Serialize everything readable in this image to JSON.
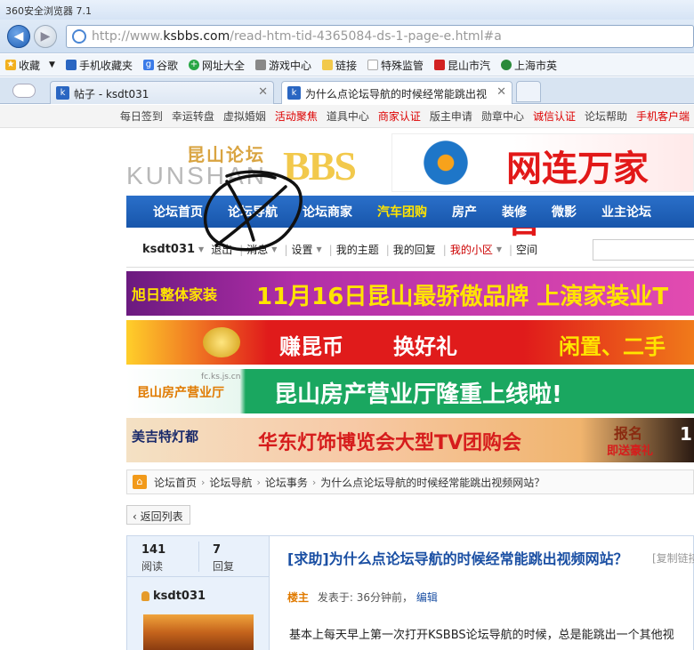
{
  "window": {
    "title": "360安全浏览器 7.1"
  },
  "addressbar": {
    "url_prefix": "http://www.",
    "url_domain": "ksbbs.com",
    "url_path": "/read-htm-tid-4365084-ds-1-page-e.html#a"
  },
  "bookmarks": [
    {
      "label": "收藏",
      "icon": "star-icon",
      "color": "#f2b01e"
    },
    {
      "label": "手机收藏夹",
      "icon": "phone-icon",
      "color": "#2a66c2"
    },
    {
      "label": "谷歌",
      "icon": "google-icon",
      "color": "#3b7be8"
    },
    {
      "label": "网址大全",
      "icon": "plus-icon",
      "color": "#28a745"
    },
    {
      "label": "游戏中心",
      "icon": "gamepad-icon",
      "color": "#888888"
    },
    {
      "label": "链接",
      "icon": "folder-icon",
      "color": "#f2c94c"
    },
    {
      "label": "特殊监管",
      "icon": "page-icon",
      "color": "#aaaaaa"
    },
    {
      "label": "昆山市汽",
      "icon": "bbs-icon",
      "color": "#d22222"
    },
    {
      "label": "上海市英",
      "icon": "globe-icon",
      "color": "#2a8a3a"
    }
  ],
  "tabs": [
    {
      "label": "帖子 - ksdt031"
    },
    {
      "label": "为什么点论坛导航的时候经常能跳出视"
    }
  ],
  "site_topbar": [
    {
      "label": "每日签到",
      "red": false
    },
    {
      "label": "幸运转盘",
      "red": false
    },
    {
      "label": "虚拟婚姻",
      "red": false
    },
    {
      "label": "活动聚焦",
      "red": true
    },
    {
      "label": "道具中心",
      "red": false
    },
    {
      "label": "商家认证",
      "red": true
    },
    {
      "label": "版主申请",
      "red": false
    },
    {
      "label": "勋章中心",
      "red": false
    },
    {
      "label": "诚信认证",
      "red": true
    },
    {
      "label": "论坛帮助",
      "red": false
    },
    {
      "label": "手机客户端",
      "red": true
    }
  ],
  "logo": {
    "cn": "昆山论坛",
    "en": "KUNSHAN",
    "bbs": "BBS"
  },
  "top_ad": {
    "text": "网连万家 智"
  },
  "main_nav": [
    {
      "label": "论坛首页",
      "hl": false
    },
    {
      "label": "论坛导航",
      "hl": false
    },
    {
      "label": "论坛商家",
      "hl": false
    },
    {
      "label": "汽车团购",
      "hl": true
    },
    {
      "label": "房产",
      "hl": false
    },
    {
      "label": "装修",
      "hl": false
    },
    {
      "label": "微影",
      "hl": false
    },
    {
      "label": "业主论坛",
      "hl": false
    }
  ],
  "userbar": {
    "username": "ksdt031",
    "logout": "退出",
    "messages": "消息",
    "settings": "设置",
    "my_topics": "我的主题",
    "my_replies": "我的回复",
    "my_area": "我的小区",
    "space": "空间"
  },
  "banners": [
    {
      "brand": "旭日整体家装",
      "text": "11月16日昆山最骄傲品牌 上演家装业T"
    },
    {
      "text1": "赚昆币",
      "text2": "换好礼",
      "text3": "闲置、二手"
    },
    {
      "brand": "昆山房产营业厅",
      "url": "fc.ks.js.cn",
      "text": "昆山房产营业厅隆重上线啦!"
    },
    {
      "brand": "美吉特灯都",
      "text": "华东灯饰博览会大型TV团购会",
      "badge1": "报名",
      "badge2": "即送豪礼",
      "corner": "1"
    }
  ],
  "breadcrumb": [
    "论坛首页",
    "论坛导航",
    "论坛事务",
    "为什么点论坛导航的时候经常能跳出视频网站？"
  ],
  "back_to_list": "‹ 返回列表",
  "thread": {
    "views": "141",
    "views_label": "阅读",
    "replies": "7",
    "replies_label": "回复",
    "title": "[求助]为什么点论坛导航的时候经常能跳出视频网站？",
    "copy_link": "[复制链接]",
    "author": "ksdt031",
    "role": "楼主",
    "posted": "发表于: 36分钟前，",
    "edit": "编辑",
    "body": "基本上每天早上第一次打开KSBBS论坛导航的时候，总是能跳出一个其他视"
  }
}
